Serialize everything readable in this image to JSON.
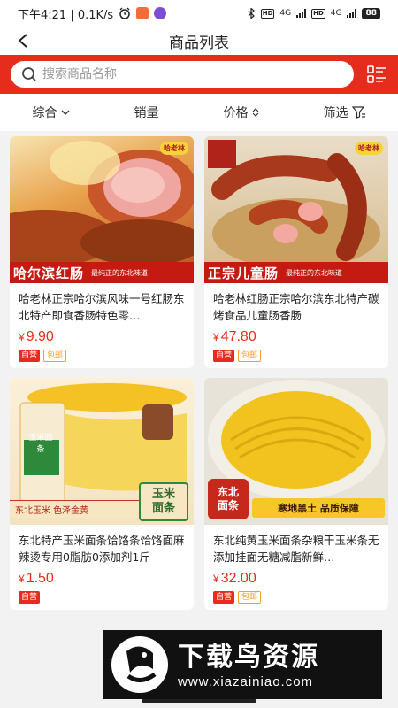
{
  "status_bar": {
    "time_speed": "下午4:21 | 0.1K/s",
    "battery": "88",
    "hd1": "HD",
    "hd2": "HD",
    "net1": "4G",
    "net2": "4G"
  },
  "nav": {
    "title": "商品列表"
  },
  "search": {
    "placeholder": "搜索商品名称"
  },
  "sort": {
    "comprehensive": "综合",
    "sales": "销量",
    "price": "价格",
    "filter": "筛选"
  },
  "products": [
    {
      "title": "哈老林正宗哈尔滨风味一号红肠东北特产即食香肠特色零…",
      "price": "9.90",
      "tag_self": "自营",
      "tag_ship": "包邮",
      "banner_main": "哈尔滨红肠",
      "banner_sub": "最纯正的东北味道",
      "logo": "哈老林"
    },
    {
      "title": "哈老林红肠正宗哈尔滨东北特产碳烤食品儿童肠香肠",
      "price": "47.80",
      "tag_self": "自营",
      "tag_ship": "包邮",
      "banner_main": "正宗儿童肠",
      "banner_sub": "最纯正的东北味道",
      "logo": "哈老林"
    },
    {
      "title": "东北特产玉米面条饸饹条饸饹面麻辣烫专用0脂肪0添加剂1斤",
      "price": "1.50",
      "tag_self": "自营",
      "img_text1": "东北玉米 色泽金黄",
      "img_text2a": "玉米",
      "img_text2b": "面条",
      "pkg_text": "玉米面条"
    },
    {
      "title": "东北纯黄玉米面条杂粮干玉米条无添加挂面无糖减脂新鲜…",
      "price": "32.00",
      "tag_self": "自营",
      "tag_ship": "包邮",
      "img_text1a": "东北",
      "img_text1b": "面条",
      "img_text2": "寒地黑土 品质保障"
    }
  ],
  "currency": "¥",
  "watermark": {
    "main": "下载鸟资源",
    "url": "www.xiazainiao.com"
  },
  "colors": {
    "brand_red": "#e52c1d",
    "price_red": "#e52c1d",
    "ship_orange": "#f0a030"
  }
}
